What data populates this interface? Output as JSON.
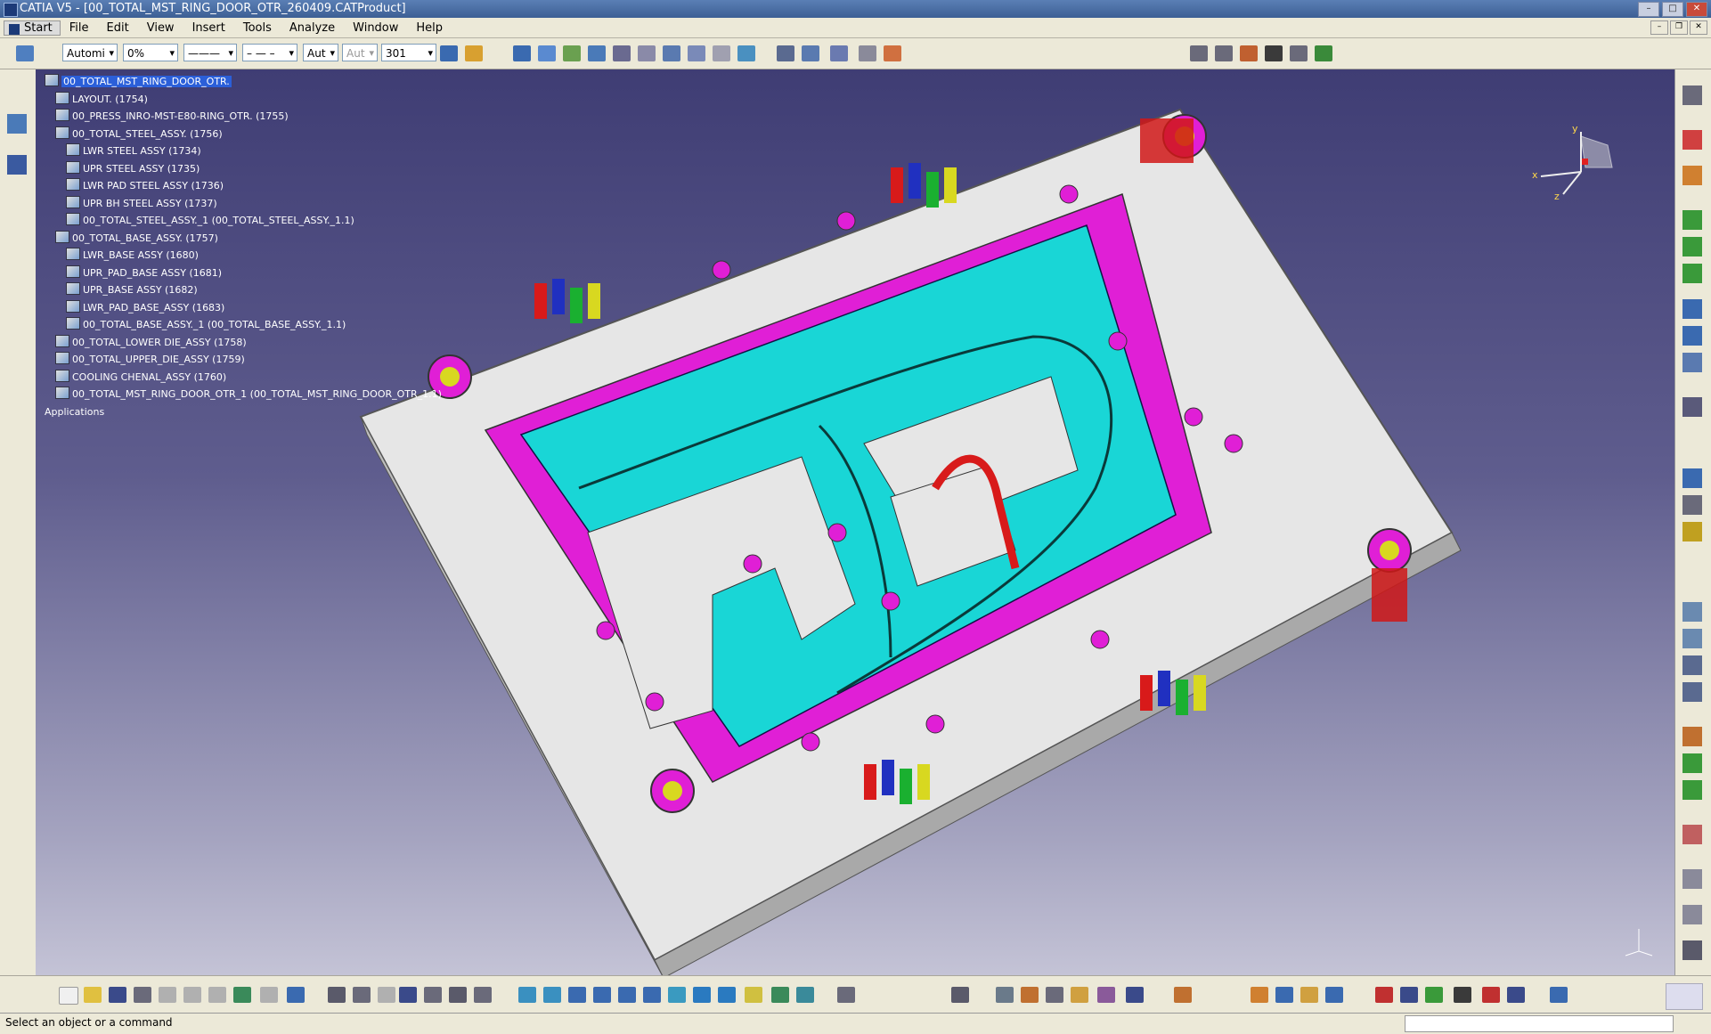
{
  "window": {
    "title": "CATIA V5 - [00_TOTAL_MST_RING_DOOR_OTR_260409.CATProduct]"
  },
  "menu": {
    "items": [
      "Start",
      "File",
      "Edit",
      "View",
      "Insert",
      "Tools",
      "Analyze",
      "Window",
      "Help"
    ]
  },
  "toolbar": {
    "color_combo": "Automi",
    "transparency_combo": "0%",
    "line_weight_combo": "———",
    "line_type_combo": "– — –",
    "point_combo": "Aut",
    "point_combo2": "Aut",
    "layer_combo": "301"
  },
  "tree": {
    "items": [
      "00_TOTAL_MST_RING_DOOR_OTR.",
      "LAYOUT. (1754)",
      "00_PRESS_INRO-MST-E80-RING_OTR. (1755)",
      "00_TOTAL_STEEL_ASSY. (1756)",
      "LWR STEEL ASSY (1734)",
      "UPR STEEL ASSY (1735)",
      "LWR PAD STEEL ASSY (1736)",
      "UPR BH STEEL ASSY (1737)",
      "00_TOTAL_STEEL_ASSY._1 (00_TOTAL_STEEL_ASSY._1.1)",
      "00_TOTAL_BASE_ASSY. (1757)",
      "LWR_BASE ASSY (1680)",
      "UPR_PAD_BASE ASSY (1681)",
      "UPR_BASE ASSY (1682)",
      "LWR_PAD_BASE_ASSY (1683)",
      "00_TOTAL_BASE_ASSY._1 (00_TOTAL_BASE_ASSY._1.1)",
      "00_TOTAL_LOWER DIE_ASSY (1758)",
      "00_TOTAL_UPPER_DIE_ASSY (1759)",
      "COOLING CHENAL_ASSY (1760)",
      "00_TOTAL_MST_RING_DOOR_OTR_1 (00_TOTAL_MST_RING_DOOR_OTR_1.1)",
      "Applications"
    ]
  },
  "status": {
    "message": "Select an object or a command"
  },
  "compass_axes": {
    "x": "x",
    "y": "y",
    "z": "z"
  },
  "colors": {
    "viewport_top": "#3f3d74",
    "viewport_bottom": "#c4c3d6",
    "die_cyan": "#19d6d6",
    "die_magenta": "#e01fd6",
    "die_base": "#e8e8e8",
    "selection": "#2b5fd9"
  }
}
